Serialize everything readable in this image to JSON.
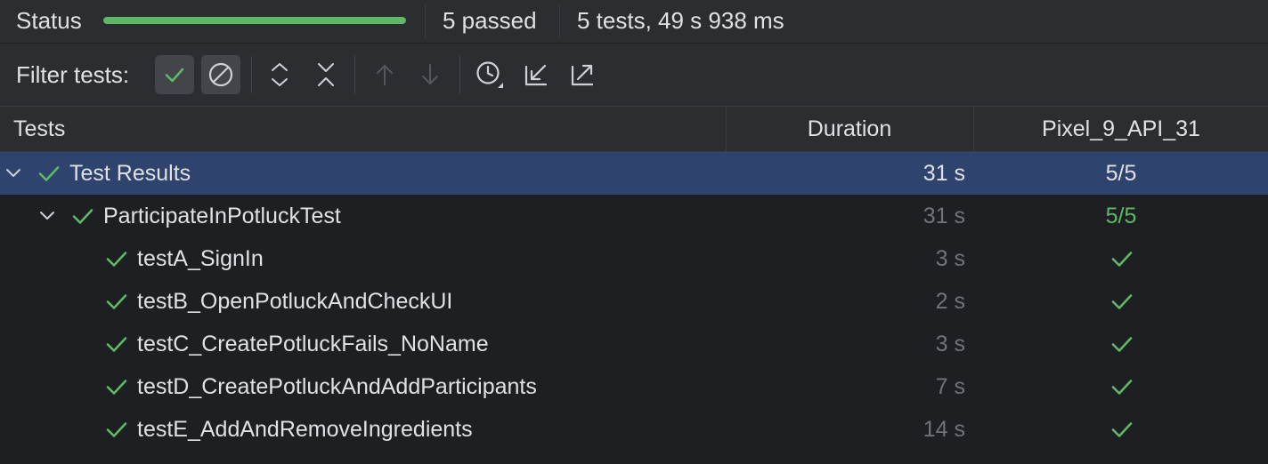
{
  "colors": {
    "pass_green": "#5fb865",
    "selection": "#2e436e",
    "progress": "#5fb865"
  },
  "status": {
    "label": "Status",
    "progress_fraction": 1.0,
    "passed": "5 passed",
    "summary": "5 tests, 49 s 938 ms"
  },
  "toolbar": {
    "filter_label": "Filter tests:",
    "buttons": [
      {
        "icon": "show-passed-icon",
        "pressed": true
      },
      {
        "icon": "show-ignored-icon",
        "pressed": true
      },
      {
        "icon": "expand-all-icon",
        "pressed": false
      },
      {
        "icon": "collapse-all-icon",
        "pressed": false
      },
      {
        "icon": "previous-failed-icon",
        "pressed": false,
        "disabled": true
      },
      {
        "icon": "next-failed-icon",
        "pressed": false,
        "disabled": true
      },
      {
        "icon": "test-history-icon",
        "pressed": false
      },
      {
        "icon": "import-tests-icon",
        "pressed": false
      },
      {
        "icon": "export-tests-icon",
        "pressed": false
      }
    ]
  },
  "columns": {
    "tests": "Tests",
    "duration": "Duration",
    "device": "Pixel_9_API_31"
  },
  "rows": [
    {
      "name": "Test Results",
      "duration": "31 s",
      "device": "5/5",
      "level": 0,
      "expandable": true,
      "selected": true
    },
    {
      "name": "ParticipateInPotluckTest",
      "duration": "31 s",
      "device": "5/5",
      "level": 1,
      "expandable": true,
      "selected": false
    },
    {
      "name": "testA_SignIn",
      "duration": "3 s",
      "device": "passed",
      "level": 2,
      "expandable": false,
      "selected": false
    },
    {
      "name": "testB_OpenPotluckAndCheckUI",
      "duration": "2 s",
      "device": "passed",
      "level": 2,
      "expandable": false,
      "selected": false
    },
    {
      "name": "testC_CreatePotluckFails_NoName",
      "duration": "3 s",
      "device": "passed",
      "level": 2,
      "expandable": false,
      "selected": false
    },
    {
      "name": "testD_CreatePotluckAndAddParticipants",
      "duration": "7 s",
      "device": "passed",
      "level": 2,
      "expandable": false,
      "selected": false
    },
    {
      "name": "testE_AddAndRemoveIngredients",
      "duration": "14 s",
      "device": "passed",
      "level": 2,
      "expandable": false,
      "selected": false
    }
  ]
}
